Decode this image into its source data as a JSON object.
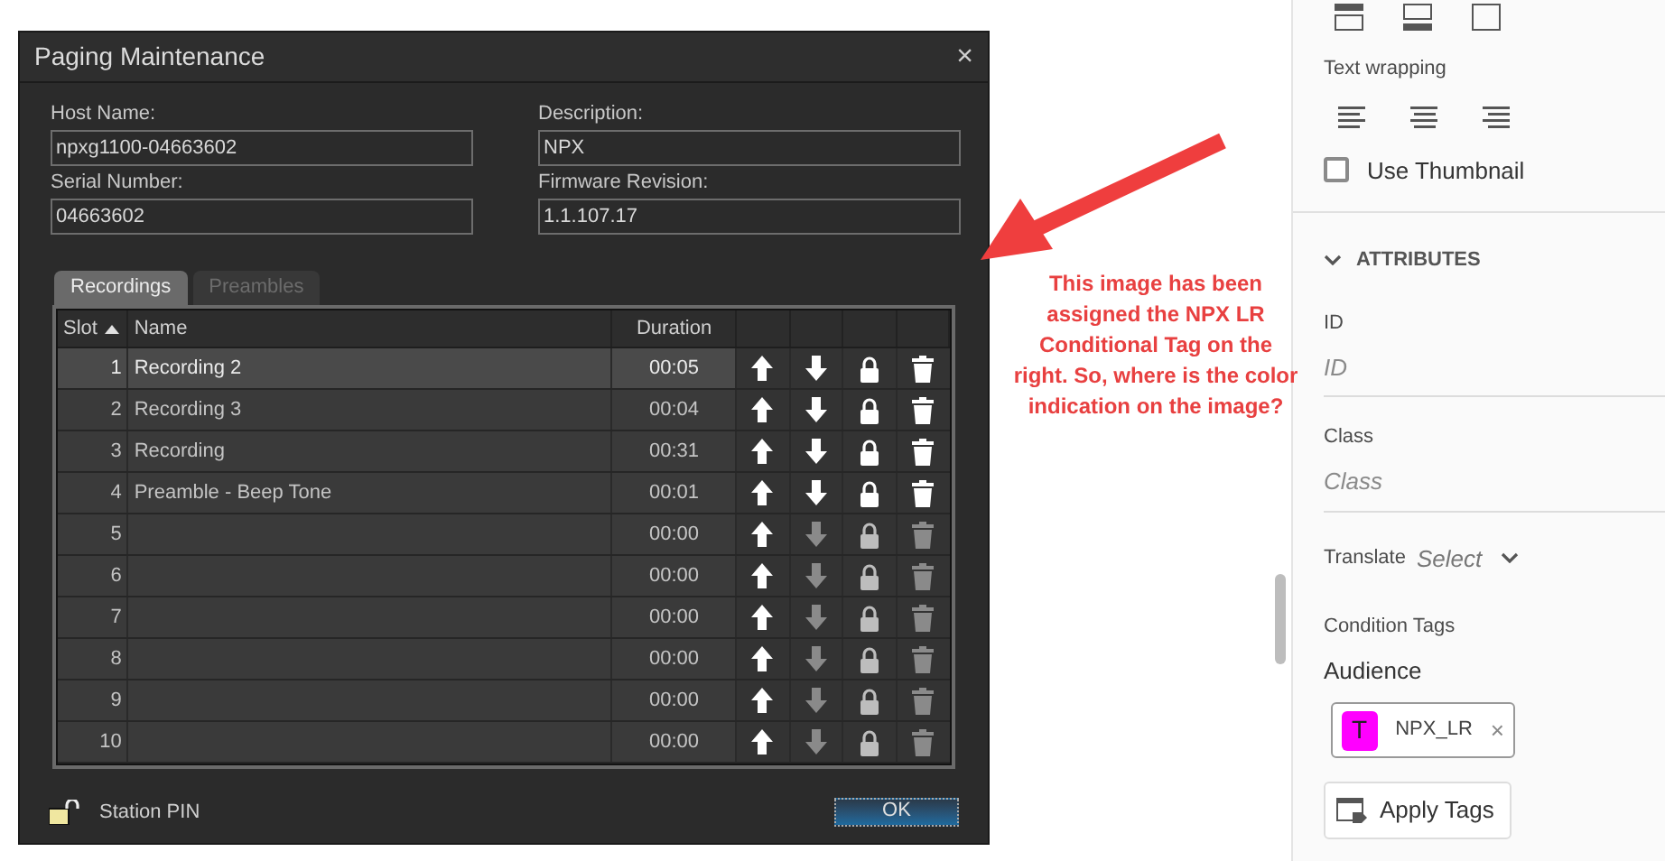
{
  "dialog": {
    "title": "Paging Maintenance",
    "close": "×",
    "fields": [
      {
        "label": "Host Name:",
        "value": "npxg1100-04663602"
      },
      {
        "label": "Description:",
        "value": "NPX"
      },
      {
        "label": "Serial Number:",
        "value": "04663602"
      },
      {
        "label": "Firmware Revision:",
        "value": "1.1.107.17"
      }
    ],
    "tabs": [
      {
        "label": "Recordings",
        "selected": true
      },
      {
        "label": "Preambles",
        "selected": false
      }
    ],
    "table": {
      "columns": [
        "Slot",
        "Name",
        "Duration"
      ],
      "rows": [
        {
          "slot": "1",
          "name": "Recording 2",
          "duration": "00:05",
          "selected": true,
          "enabled": true
        },
        {
          "slot": "2",
          "name": "Recording 3",
          "duration": "00:04",
          "selected": false,
          "enabled": true
        },
        {
          "slot": "3",
          "name": "Recording",
          "duration": "00:31",
          "selected": false,
          "enabled": true
        },
        {
          "slot": "4",
          "name": "Preamble - Beep Tone",
          "duration": "00:01",
          "selected": false,
          "enabled": true
        },
        {
          "slot": "5",
          "duration": "00:00",
          "selected": false,
          "enabled": false
        },
        {
          "slot": "6",
          "duration": "00:00",
          "selected": false,
          "enabled": false
        },
        {
          "slot": "7",
          "duration": "00:00",
          "selected": false,
          "enabled": false
        },
        {
          "slot": "8",
          "duration": "00:00",
          "selected": false,
          "enabled": false
        },
        {
          "slot": "9",
          "duration": "00:00",
          "selected": false,
          "enabled": false
        },
        {
          "slot": "10",
          "duration": "00:00",
          "selected": false,
          "enabled": false
        }
      ]
    },
    "station_pin": "Station PIN",
    "ok": "OK"
  },
  "annotation": [
    "This image has been",
    "assigned the NPX LR",
    "Conditional Tag on the",
    "right. So, where is the color",
    "indication on the image?"
  ],
  "sidebar": {
    "text_wrapping": "Text wrapping",
    "use_thumbnail": {
      "label": "Use Thumbnail",
      "checked": false
    },
    "attributes": {
      "heading": "ATTRIBUTES",
      "expanded": true,
      "fields": [
        {
          "label": "ID",
          "placeholder": "ID"
        },
        {
          "label": "Class",
          "placeholder": "Class"
        }
      ],
      "translate": {
        "label": "Translate",
        "value": "Select"
      }
    },
    "condition_tags": "Condition Tags",
    "audience": "Audience",
    "tags": [
      {
        "letter": "T",
        "name": "NPX_LR",
        "remove": "×",
        "color": "#ff00ff"
      }
    ],
    "apply": "Apply Tags"
  }
}
